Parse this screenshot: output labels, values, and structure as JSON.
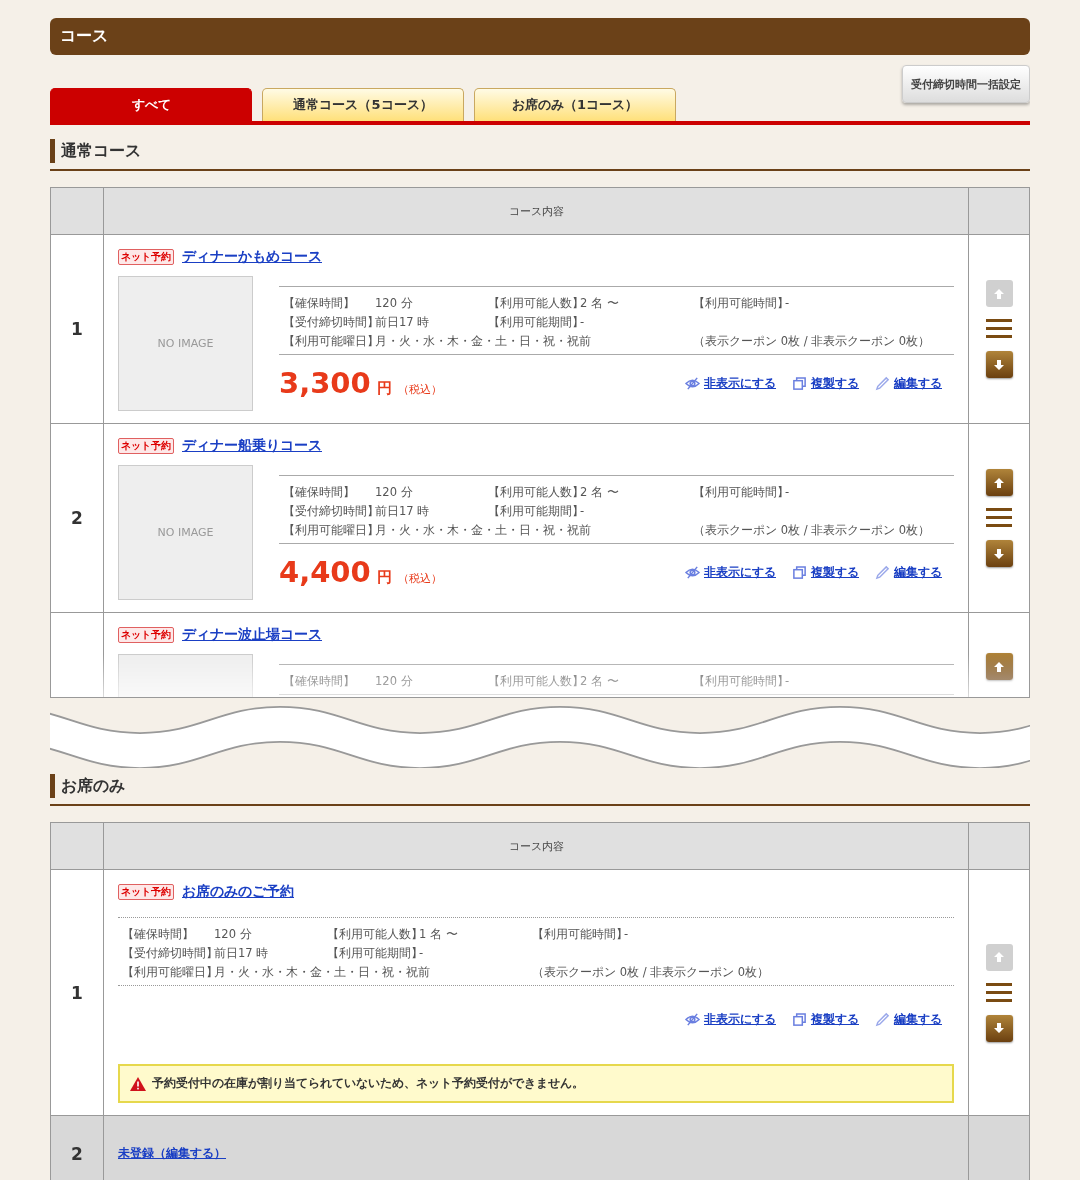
{
  "header": {
    "title": "コース"
  },
  "bulk_button": "受付締切時間一括設定",
  "tabs": [
    {
      "label": "すべて",
      "selected": true
    },
    {
      "label": "通常コース（5コース）",
      "selected": false
    },
    {
      "label": "お席のみ（1コース）",
      "selected": false
    }
  ],
  "sections": [
    {
      "title": "通常コース",
      "column_header": "コース内容",
      "rows": [
        {
          "number": "1",
          "kind": "course",
          "badge": "ネット予約",
          "name": "ディナーかもめコース",
          "image_text": "NO IMAGE",
          "lines": [
            [
              {
                "label": "【確保時間】",
                "value": "120 分"
              },
              {
                "label": "【利用可能人数】",
                "value": "2 名 〜"
              },
              {
                "label": "【利用可能時間】",
                "value": "-"
              }
            ],
            [
              {
                "label": "【受付締切時間】",
                "value": "前日17 時"
              },
              {
                "label": "【利用可能期間】",
                "value": "-"
              }
            ],
            [
              {
                "label": "【利用可能曜日】",
                "value": "月・火・水・木・金・土・日・祝・祝前"
              }
            ]
          ],
          "coupons": "（表示クーポン 0枚 / 非表示クーポン 0枚）",
          "price": "3,300",
          "currency": "円",
          "tax": "（税込）",
          "actions": [
            "非表示にする",
            "複製する",
            "編集する"
          ],
          "up_enabled": false,
          "down_enabled": true
        },
        {
          "number": "2",
          "kind": "course",
          "badge": "ネット予約",
          "name": "ディナー船乗りコース",
          "image_text": "NO IMAGE",
          "lines": [
            [
              {
                "label": "【確保時間】",
                "value": "120 分"
              },
              {
                "label": "【利用可能人数】",
                "value": "2 名 〜"
              },
              {
                "label": "【利用可能時間】",
                "value": "-"
              }
            ],
            [
              {
                "label": "【受付締切時間】",
                "value": "前日17 時"
              },
              {
                "label": "【利用可能期間】",
                "value": "-"
              }
            ],
            [
              {
                "label": "【利用可能曜日】",
                "value": "月・火・水・木・金・土・日・祝・祝前"
              }
            ]
          ],
          "coupons": "（表示クーポン 0枚 / 非表示クーポン 0枚）",
          "price": "4,400",
          "currency": "円",
          "tax": "（税込）",
          "actions": [
            "非表示にする",
            "複製する",
            "編集する"
          ],
          "up_enabled": true,
          "down_enabled": true
        },
        {
          "number": "",
          "kind": "course",
          "badge": "ネット予約",
          "name": "ディナー波止場コース",
          "lines": [
            [
              {
                "label": "【確保時間】",
                "value": "120 分"
              },
              {
                "label": "【利用可能人数】",
                "value": "2 名 〜"
              },
              {
                "label": "【利用可能時間】",
                "value": "-"
              }
            ]
          ],
          "up_enabled": true,
          "cut": true
        }
      ]
    },
    {
      "title": "お席のみ",
      "column_header": "コース内容",
      "rows": [
        {
          "number": "1",
          "kind": "seat",
          "badge": "ネット予約",
          "name": "お席のみのご予約",
          "lines": [
            [
              {
                "label": "【確保時間】",
                "value": "120 分"
              },
              {
                "label": "【利用可能人数】",
                "value": "1 名 〜"
              },
              {
                "label": "【利用可能時間】",
                "value": "-"
              }
            ],
            [
              {
                "label": "【受付締切時間】",
                "value": "前日17 時"
              },
              {
                "label": "【利用可能期間】",
                "value": "-"
              }
            ],
            [
              {
                "label": "【利用可能曜日】",
                "value": "月・火・水・木・金・土・日・祝・祝前"
              }
            ]
          ],
          "coupons": "（表示クーポン 0枚 / 非表示クーポン 0枚）",
          "actions": [
            "非表示にする",
            "複製する",
            "編集する"
          ],
          "warning": "予約受付中の在庫が割り当てられていないため、ネット予約受付ができません。",
          "up_enabled": false,
          "down_enabled": true
        },
        {
          "number": "2",
          "kind": "empty",
          "name": "未登録（編集する）"
        }
      ]
    }
  ]
}
